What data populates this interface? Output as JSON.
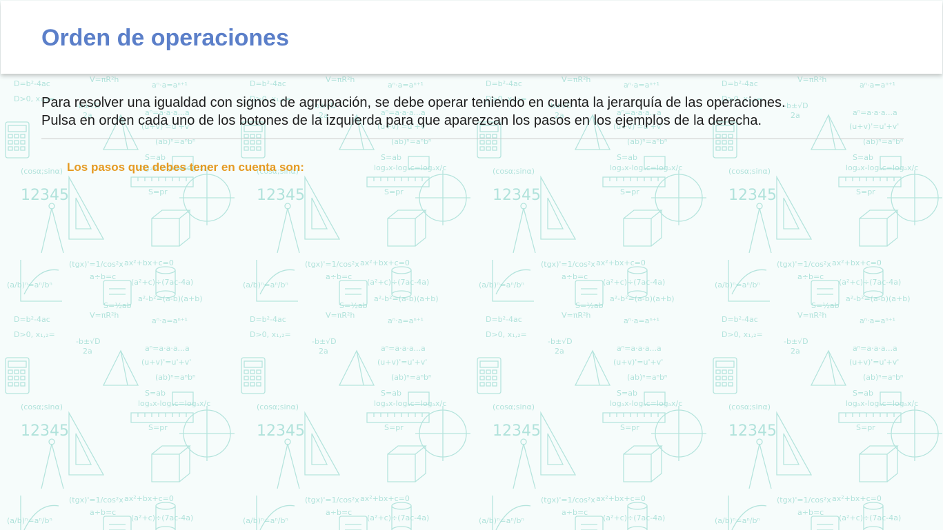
{
  "header": {
    "title": "Orden de operaciones"
  },
  "intro": {
    "line1": "Para resolver una igualdad con signos de agrupación, se debe operar teniendo en cuenta la jerarquía de las operaciones.",
    "line2": "Pulsa en orden cada uno de los botones de la izquierda para que aparezcan los pasos en los ejemplos de la derecha."
  },
  "steps": {
    "heading": "Los pasos que debes tener en cuenta son:"
  },
  "colors": {
    "title": "#5b7fc9",
    "steps_heading": "#e59a22",
    "pattern": "#8fd8cf",
    "background": "#f6fcfb"
  },
  "background": {
    "icon": "math-doodle-pattern"
  }
}
